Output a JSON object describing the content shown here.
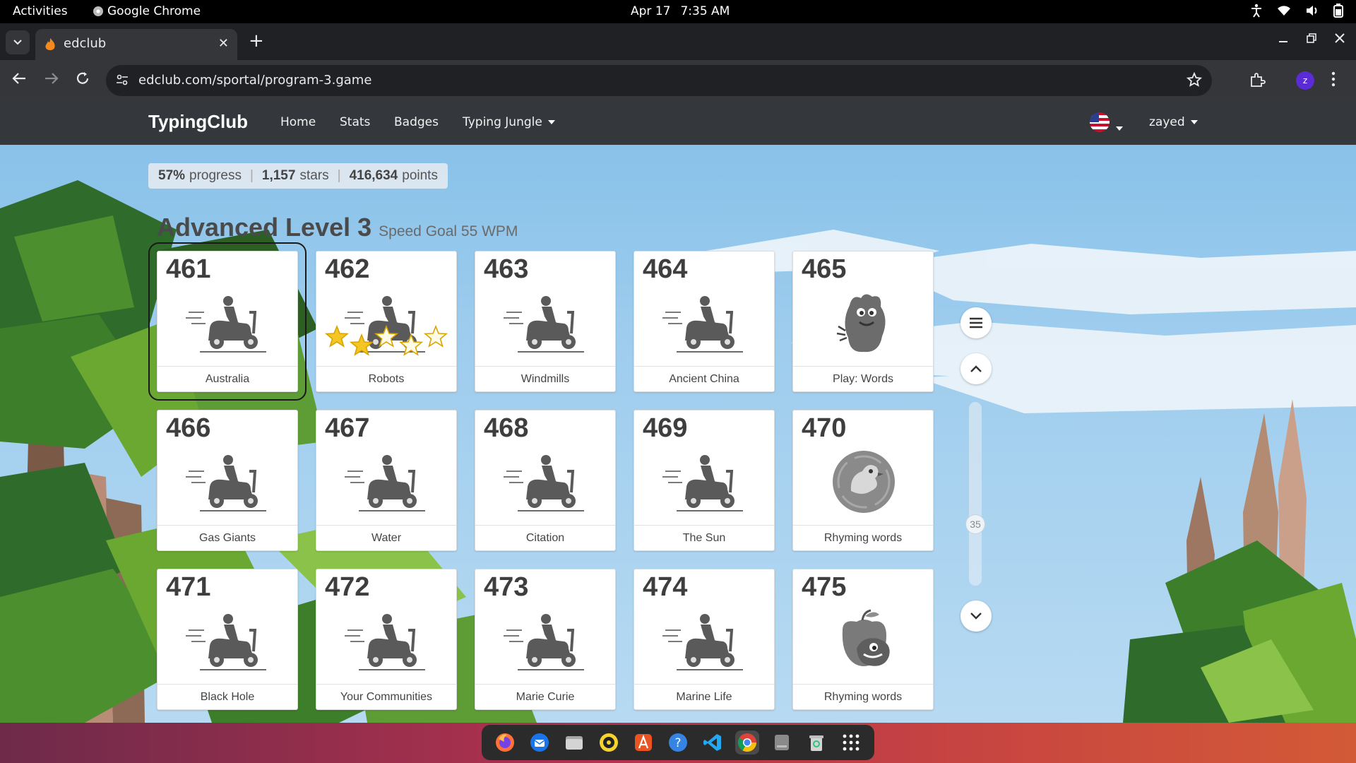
{
  "os": {
    "activities": "Activities",
    "app_name": "Google Chrome",
    "date": "Apr 17",
    "time": "7:35 AM"
  },
  "browser": {
    "tab_title": "edclub",
    "url": "edclub.com/sportal/program-3.game",
    "profile_initial": "z"
  },
  "site": {
    "brand": "TypingClub",
    "nav": [
      "Home",
      "Stats",
      "Badges",
      "Typing Jungle"
    ],
    "user": "zayed"
  },
  "stats": {
    "progress_value": "57%",
    "progress_label": "progress",
    "stars_value": "1,157",
    "stars_label": "stars",
    "points_value": "416,634",
    "points_label": "points"
  },
  "level": {
    "title": "Advanced Level 3",
    "goal": "Speed Goal 55 WPM"
  },
  "lessons": [
    {
      "num": "461",
      "label": "Australia",
      "icon": "scooter-icon",
      "selected": true
    },
    {
      "num": "462",
      "label": "Robots",
      "icon": "scooter-icon",
      "stars": 2,
      "stars_total": 5
    },
    {
      "num": "463",
      "label": "Windmills",
      "icon": "scooter-icon"
    },
    {
      "num": "464",
      "label": "Ancient China",
      "icon": "scooter-icon"
    },
    {
      "num": "465",
      "label": "Play: Words",
      "icon": "monster-icon"
    },
    {
      "num": "466",
      "label": "Gas Giants",
      "icon": "scooter-icon"
    },
    {
      "num": "467",
      "label": "Water",
      "icon": "scooter-icon"
    },
    {
      "num": "468",
      "label": "Citation",
      "icon": "scooter-icon"
    },
    {
      "num": "469",
      "label": "The Sun",
      "icon": "scooter-icon"
    },
    {
      "num": "470",
      "label": "Rhyming words",
      "icon": "bird-coin-icon"
    },
    {
      "num": "471",
      "label": "Black Hole",
      "icon": "scooter-icon"
    },
    {
      "num": "472",
      "label": "Your Communities",
      "icon": "scooter-icon"
    },
    {
      "num": "473",
      "label": "Marie Curie",
      "icon": "scooter-icon"
    },
    {
      "num": "474",
      "label": "Marine Life",
      "icon": "scooter-icon"
    },
    {
      "num": "475",
      "label": "Rhyming words",
      "icon": "apple-bird-icon"
    }
  ],
  "scroller": {
    "indicator": "35"
  },
  "dock": [
    "firefox-icon",
    "thunderbird-icon",
    "files-icon",
    "rhythmbox-icon",
    "app-center-icon",
    "help-icon",
    "vscode-icon",
    "chrome-icon",
    "disk-icon",
    "trash-icon",
    "app-grid-icon"
  ],
  "colors": {
    "nav_bg": "#34383c",
    "sky": "#9fcdee",
    "star": "#f3c623"
  }
}
